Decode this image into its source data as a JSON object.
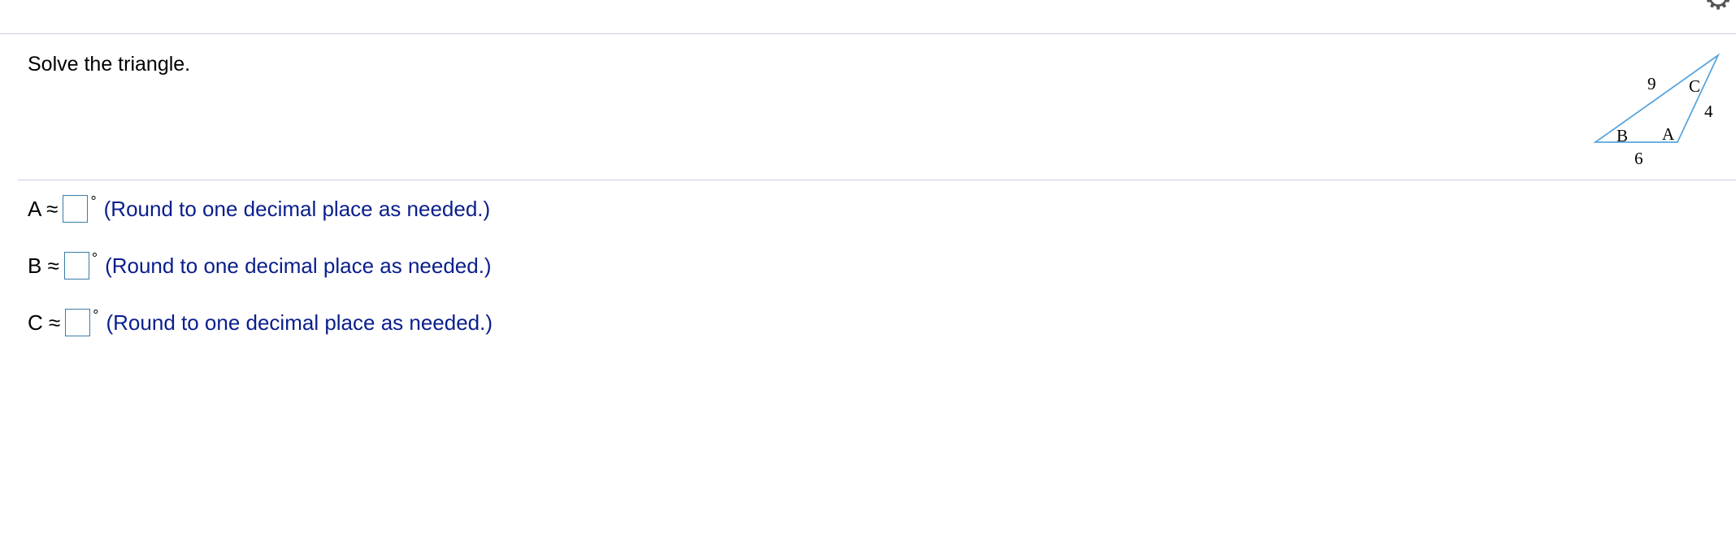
{
  "toolbar": {
    "settings_icon": "gear-icon"
  },
  "question": {
    "prompt": "Solve the triangle."
  },
  "figure": {
    "side_top": "9",
    "side_right": "4",
    "side_bottom": "6",
    "angle_a": "A",
    "angle_b": "B",
    "angle_c": "C",
    "stroke_color": "#5aa6de"
  },
  "answers": [
    {
      "variable": "A",
      "approx": "≈",
      "value": "",
      "unit": "°",
      "hint": "(Round to one decimal place as needed.)"
    },
    {
      "variable": "B",
      "approx": "≈",
      "value": "",
      "unit": "°",
      "hint": "(Round to one decimal place as needed.)"
    },
    {
      "variable": "C",
      "approx": "≈",
      "value": "",
      "unit": "°",
      "hint": "(Round to one decimal place as needed.)"
    }
  ]
}
